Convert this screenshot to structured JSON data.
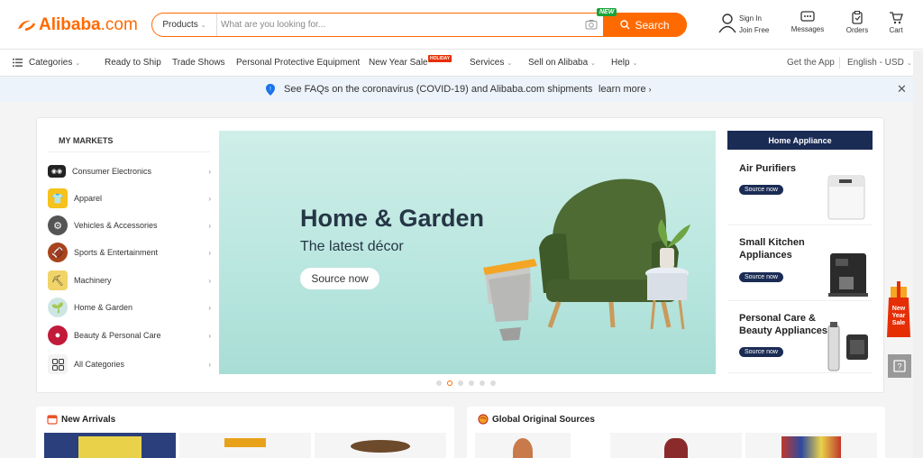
{
  "header": {
    "logo": {
      "brand": "Alibaba",
      "suffix": ".com"
    },
    "search": {
      "category": "Products",
      "placeholder": "What are you looking for...",
      "button": "Search",
      "new_badge": "NEW"
    },
    "tools": [
      {
        "name": "sign-in",
        "line1": "Sign In",
        "line2": "Join Free"
      },
      {
        "name": "messages",
        "label": "Messages"
      },
      {
        "name": "orders",
        "label": "Orders"
      },
      {
        "name": "cart",
        "label": "Cart"
      }
    ]
  },
  "nav": {
    "categories": "Categories",
    "items": [
      "Ready to Ship",
      "Trade Shows",
      "Personal Protective Equipment",
      "New Year Sale",
      "Services",
      "Sell on Alibaba",
      "Help"
    ],
    "holiday_badge": "HOLIDAY",
    "get_app": "Get the App",
    "locale": "English - USD"
  },
  "notice": {
    "text": "See FAQs on the coronavirus (COVID-19) and Alibaba.com shipments",
    "link": "learn more"
  },
  "markets": {
    "title": "MY MARKETS",
    "items": [
      "Consumer Electronics",
      "Apparel",
      "Vehicles & Accessories",
      "Sports & Entertainment",
      "Machinery",
      "Home & Garden",
      "Beauty & Personal Care",
      "All Categories"
    ]
  },
  "hero": {
    "title": "Home & Garden",
    "subtitle": "The latest décor",
    "button": "Source now",
    "active_slide": 2,
    "slides": 6
  },
  "home_appliance": {
    "title": "Home Appliance",
    "items": [
      {
        "title": "Air Purifiers",
        "button": "Source now"
      },
      {
        "title": "Small Kitchen Appliances",
        "button": "Source now"
      },
      {
        "title": "Personal Care & Beauty Appliances",
        "button": "Source now"
      }
    ]
  },
  "sections": {
    "new_arrivals": "New Arrivals",
    "global_sources": "Global Original Sources"
  },
  "promo": {
    "text": "New Year Sale"
  },
  "colors": {
    "brand": "#ff6a00",
    "navy": "#1a2b54",
    "notice_bg": "#ecf3fb"
  }
}
